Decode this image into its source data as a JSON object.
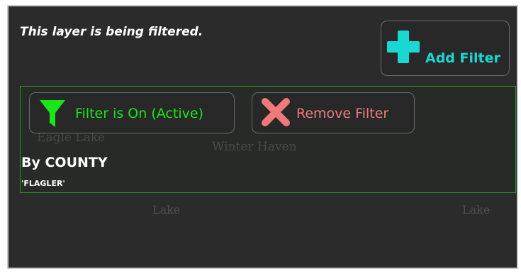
{
  "panel": {
    "title": "This layer is being filtered.",
    "map_labels": [
      "Eagle Lake",
      "Winter Haven",
      "Lake",
      "Lake"
    ]
  },
  "buttons": {
    "add_filter": "Add Filter",
    "filter_status": "Filter is On (Active)",
    "remove_filter": "Remove Filter"
  },
  "filter": {
    "by": "By COUNTY",
    "value": "'FLAGLER'"
  },
  "colors": {
    "accent_cyan": "#19d7d1",
    "active_green": "#19e619",
    "remove_red": "#f07a7a",
    "border_green": "#1fa21f"
  },
  "icons": {
    "add": "plus-icon",
    "filter": "funnel-icon",
    "remove": "x-icon"
  }
}
